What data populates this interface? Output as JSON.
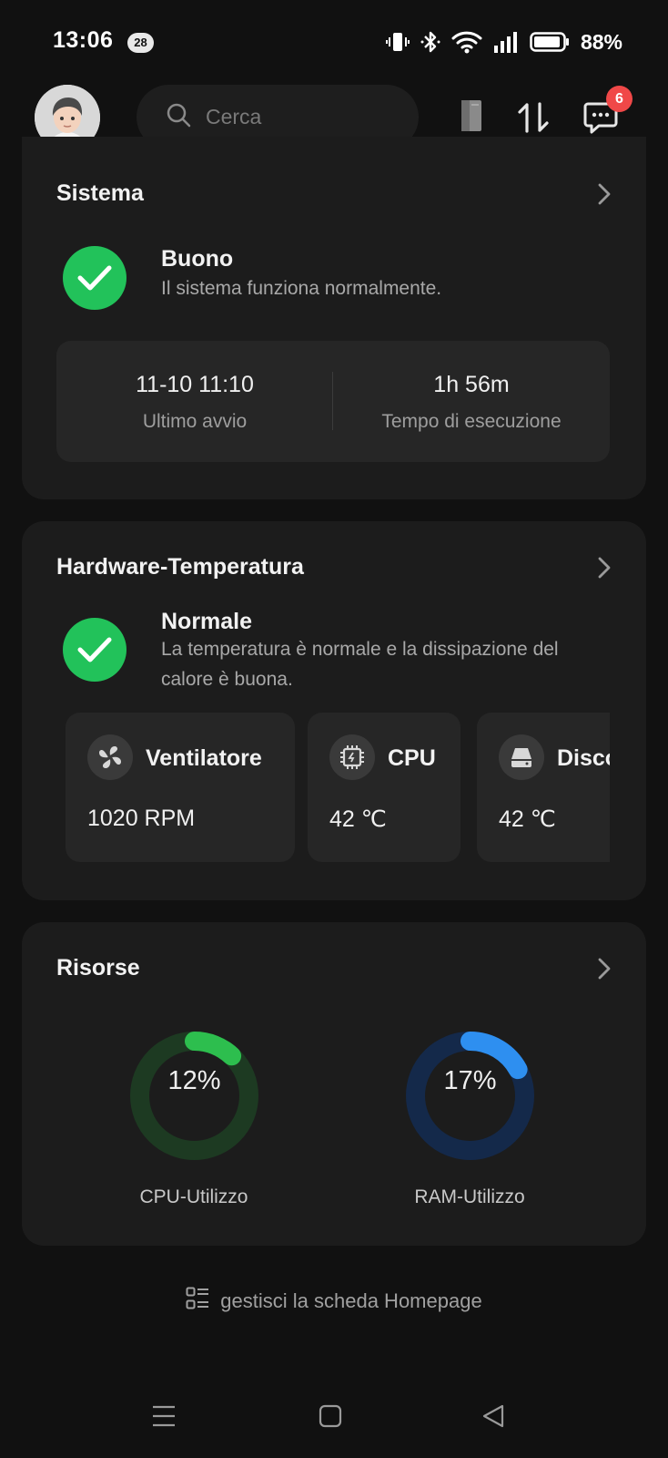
{
  "status_bar": {
    "time": "13:06",
    "notification_count": "28",
    "battery_percent": "88%"
  },
  "top_bar": {
    "search_placeholder": "Cerca",
    "message_badge": "6"
  },
  "sistema": {
    "title": "Sistema",
    "status_title": "Buono",
    "status_desc": "Il sistema funziona normalmente.",
    "last_boot_value": "11-10 11:10",
    "last_boot_label": "Ultimo avvio",
    "uptime_value": "1h 56m",
    "uptime_label": "Tempo di esecuzione"
  },
  "hardware": {
    "title": "Hardware-Temperatura",
    "status_title": "Normale",
    "status_desc_line1": "La temperatura è normale e la dissipazione del",
    "status_desc_line2": "calore è buona.",
    "tiles": [
      {
        "name": "Ventilatore",
        "value": "1020 RPM",
        "icon": "fan-icon"
      },
      {
        "name": "CPU",
        "value": "42 ℃",
        "icon": "cpu-chip-icon"
      },
      {
        "name": "Disco",
        "value": "42 ℃",
        "icon": "disk-icon"
      }
    ]
  },
  "risorse": {
    "title": "Risorse",
    "cpu": {
      "percent": 12,
      "percent_text": "12%",
      "label": "CPU-Utilizzo",
      "color": "#2dbe4e",
      "track": "#1d3a22"
    },
    "ram": {
      "percent": 17,
      "percent_text": "17%",
      "label": "RAM-Utilizzo",
      "color": "#2e8ff0",
      "track": "#14294a"
    }
  },
  "footer": {
    "manage_label": "gestisci la scheda Homepage"
  }
}
